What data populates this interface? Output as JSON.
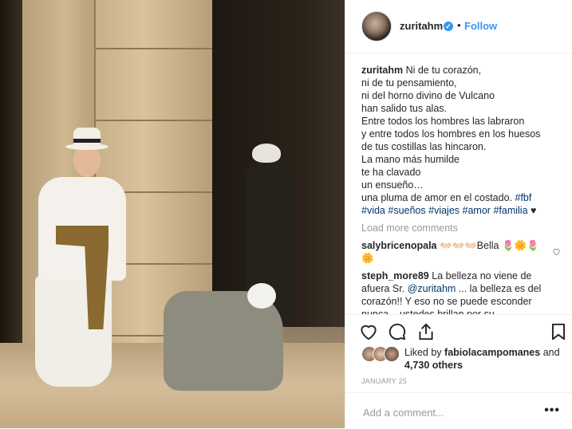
{
  "post": {
    "username": "zuritahm",
    "verified_mark": "✓",
    "separator": "•",
    "follow_label": "Follow"
  },
  "caption": {
    "username": "zuritahm",
    "lines": [
      "Ni de tu corazón,",
      "ni de tu pensamiento,",
      "ni del horno divino de Vulcano",
      "han salido tus alas.",
      "Entre todos los hombres las labraron",
      "y entre todos los hombres en los huesos",
      "de tus costillas las hincaron.",
      "La mano más humilde",
      "te ha clavado",
      "un ensueño…",
      "una pluma de amor en el costado."
    ],
    "hashtags": [
      "#fbf",
      "#vida",
      "#sueños",
      "#viajes",
      "#amor",
      "#familia"
    ],
    "trailing_emoji": "♥"
  },
  "load_more_label": "Load more comments",
  "comments": [
    {
      "username": "salybricenopala",
      "text": "👐🏻👐🏻👐🏻Bella 🌷🌼🌷🌼"
    },
    {
      "username": "steph_more89",
      "text_before": "La belleza no viene de afuera Sr. ",
      "mention": "@zuritahm",
      "text_after": " ... la belleza es del corazón!! Y eso no se puede esconder nunca... ustedes brillan por su"
    }
  ],
  "icons": {
    "like": "heart-outline-icon",
    "comment": "comment-bubble-icon",
    "share": "share-icon",
    "save": "bookmark-icon",
    "comment_like": "heart-outline-icon"
  },
  "likes": {
    "prefix": "Liked by ",
    "user": "fabiolacampomanes",
    "middle": " and",
    "others": "4,730 others"
  },
  "date": "JANUARY 25",
  "add_comment": {
    "placeholder": "Add a comment...",
    "more_label": "•••"
  },
  "colors": {
    "accent": "#3897f0",
    "hashtag": "#003569",
    "muted": "#999999",
    "text": "#262626"
  }
}
